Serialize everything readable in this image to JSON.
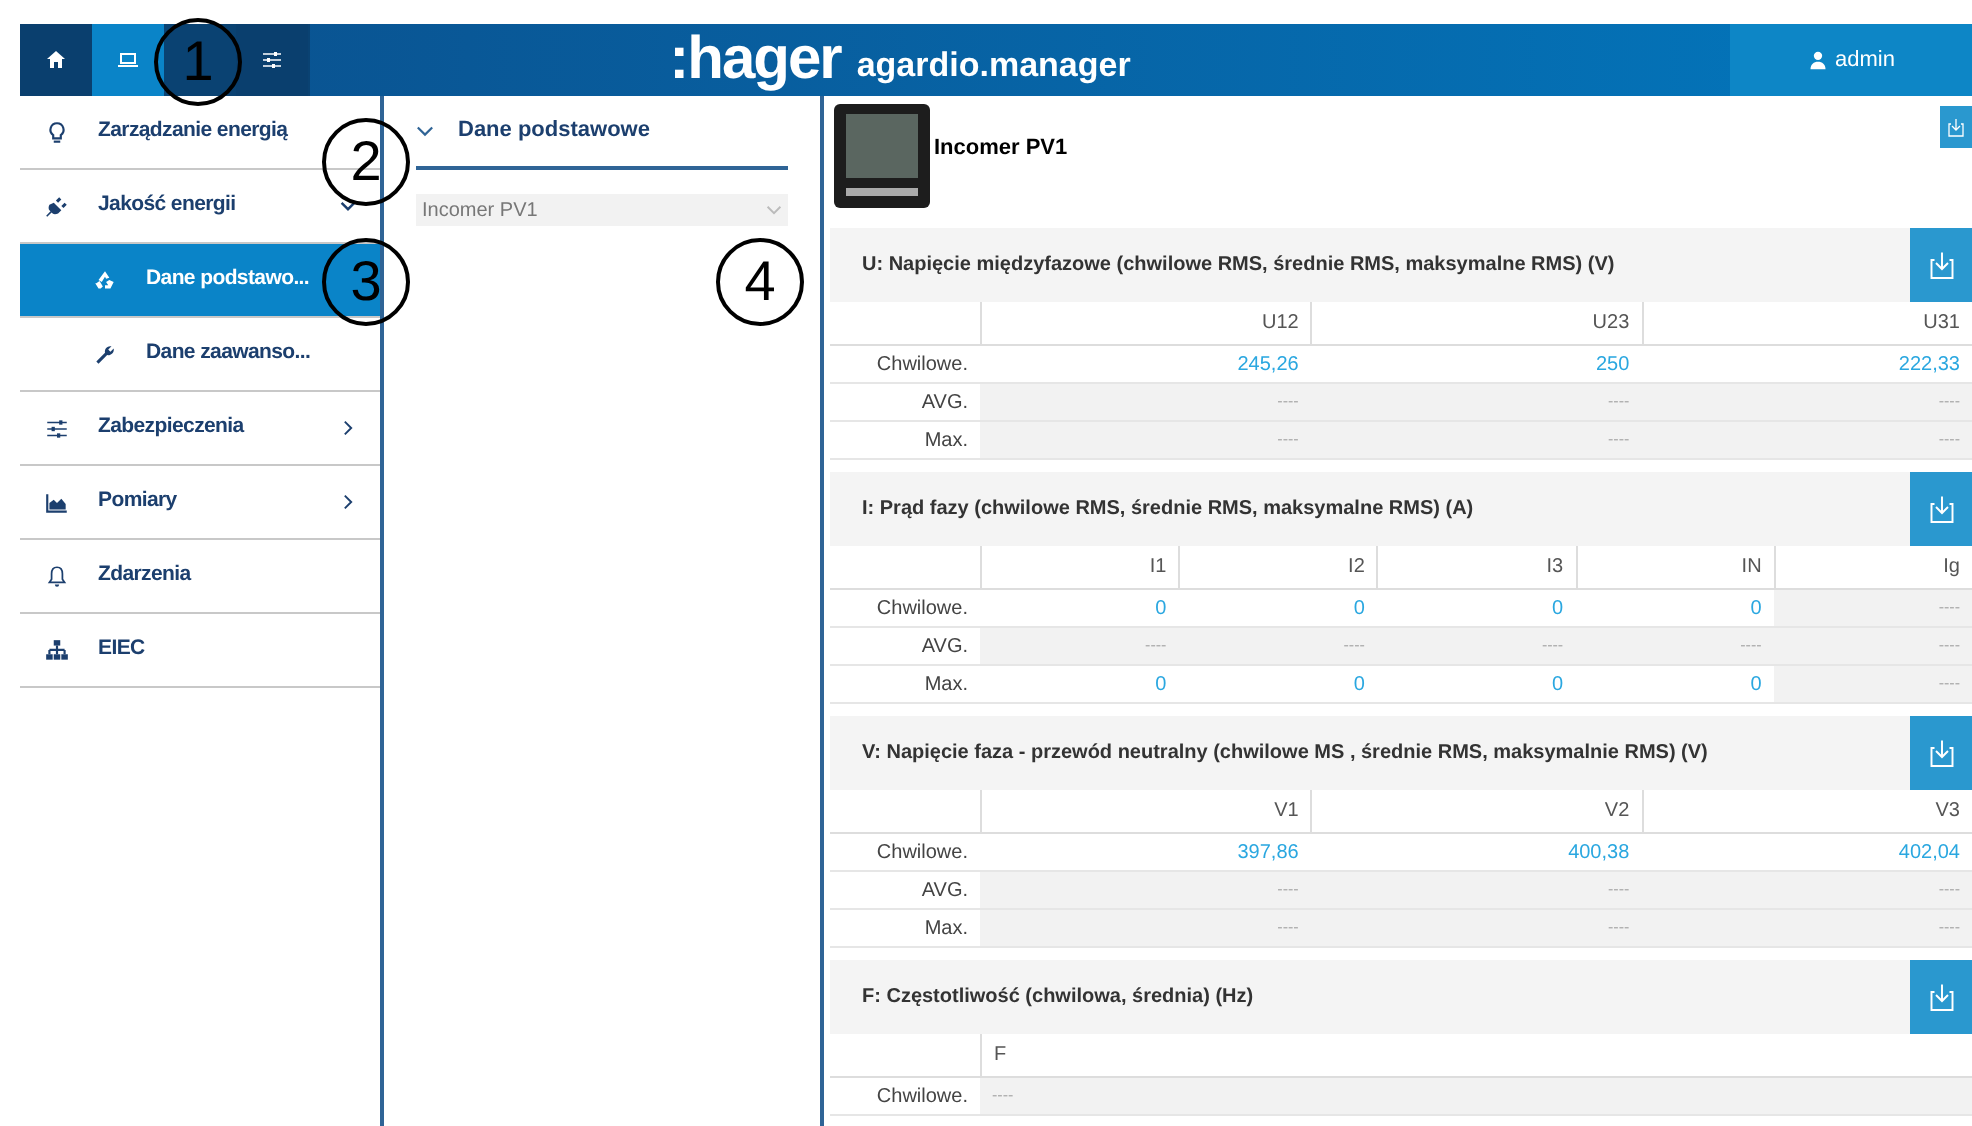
{
  "header": {
    "tabs": [
      {
        "selected": false
      },
      {
        "selected": true
      },
      {
        "selected": false
      }
    ],
    "logo": ":hager",
    "app_name": "agardio.manager",
    "user": "admin"
  },
  "sidebar": {
    "items": [
      {
        "label": "Zarządzanie energią",
        "selected": false
      },
      {
        "label": "Jakość energii",
        "expanded": true,
        "selected": false,
        "children": [
          {
            "label": "Dane podstawo...",
            "selected": true
          },
          {
            "label": "Dane zaawanso...",
            "selected": false
          }
        ]
      },
      {
        "label": "Zabezpieczenia",
        "expanded": false,
        "selected": false
      },
      {
        "label": "Pomiary",
        "expanded": false,
        "selected": false
      },
      {
        "label": "Zdarzenia",
        "selected": false
      },
      {
        "label": "EIEC",
        "selected": false
      }
    ]
  },
  "middle": {
    "section": "Dane podstawowe",
    "device_select": "Incomer PV1"
  },
  "device": {
    "name": "Incomer PV1"
  },
  "sections": [
    {
      "title": "U: Napięcie międzyfazowe (chwilowe RMS, średnie RMS, maksymalne RMS) (V)",
      "columns": [
        "U12",
        "U23",
        "U31"
      ],
      "rows": [
        {
          "label": "Chwilowe.",
          "cells": [
            {
              "text": "245,26",
              "kind": "value"
            },
            {
              "text": "250",
              "kind": "value"
            },
            {
              "text": "222,33",
              "kind": "value"
            }
          ]
        },
        {
          "label": "AVG.",
          "cells": [
            {
              "text": "----",
              "kind": "empty"
            },
            {
              "text": "----",
              "kind": "empty"
            },
            {
              "text": "----",
              "kind": "empty"
            }
          ]
        },
        {
          "label": "Max.",
          "cells": [
            {
              "text": "----",
              "kind": "empty"
            },
            {
              "text": "----",
              "kind": "empty"
            },
            {
              "text": "----",
              "kind": "empty"
            }
          ]
        }
      ]
    },
    {
      "title": "I: Prąd fazy (chwilowe RMS, średnie RMS, maksymalne RMS) (A)",
      "columns": [
        "I1",
        "I2",
        "I3",
        "IN",
        "Ig"
      ],
      "rows": [
        {
          "label": "Chwilowe.",
          "cells": [
            {
              "text": "0",
              "kind": "value"
            },
            {
              "text": "0",
              "kind": "value"
            },
            {
              "text": "0",
              "kind": "value"
            },
            {
              "text": "0",
              "kind": "value"
            },
            {
              "text": "----",
              "kind": "empty"
            }
          ]
        },
        {
          "label": "AVG.",
          "cells": [
            {
              "text": "----",
              "kind": "empty"
            },
            {
              "text": "----",
              "kind": "empty"
            },
            {
              "text": "----",
              "kind": "empty"
            },
            {
              "text": "----",
              "kind": "empty"
            },
            {
              "text": "----",
              "kind": "empty"
            }
          ]
        },
        {
          "label": "Max.",
          "cells": [
            {
              "text": "0",
              "kind": "value"
            },
            {
              "text": "0",
              "kind": "value"
            },
            {
              "text": "0",
              "kind": "value"
            },
            {
              "text": "0",
              "kind": "value"
            },
            {
              "text": "----",
              "kind": "empty"
            }
          ]
        }
      ]
    },
    {
      "title": "V: Napięcie faza - przewód neutralny (chwilowe MS , średnie RMS, maksymalnie RMS) (V)",
      "columns": [
        "V1",
        "V2",
        "V3"
      ],
      "rows": [
        {
          "label": "Chwilowe.",
          "cells": [
            {
              "text": "397,86",
              "kind": "value"
            },
            {
              "text": "400,38",
              "kind": "value"
            },
            {
              "text": "402,04",
              "kind": "value"
            }
          ]
        },
        {
          "label": "AVG.",
          "cells": [
            {
              "text": "----",
              "kind": "empty"
            },
            {
              "text": "----",
              "kind": "empty"
            },
            {
              "text": "----",
              "kind": "empty"
            }
          ]
        },
        {
          "label": "Max.",
          "cells": [
            {
              "text": "----",
              "kind": "empty"
            },
            {
              "text": "----",
              "kind": "empty"
            },
            {
              "text": "----",
              "kind": "empty"
            }
          ]
        }
      ]
    },
    {
      "title": "F: Częstotliwość (chwilowa, średnia) (Hz)",
      "columns": [
        "F"
      ],
      "rows": [
        {
          "label": "Chwilowe.",
          "cells": [
            {
              "text": "----",
              "kind": "empty"
            }
          ]
        }
      ]
    }
  ],
  "callouts": [
    {
      "text": "1"
    },
    {
      "text": "2"
    },
    {
      "text": "3"
    },
    {
      "text": "4"
    }
  ]
}
